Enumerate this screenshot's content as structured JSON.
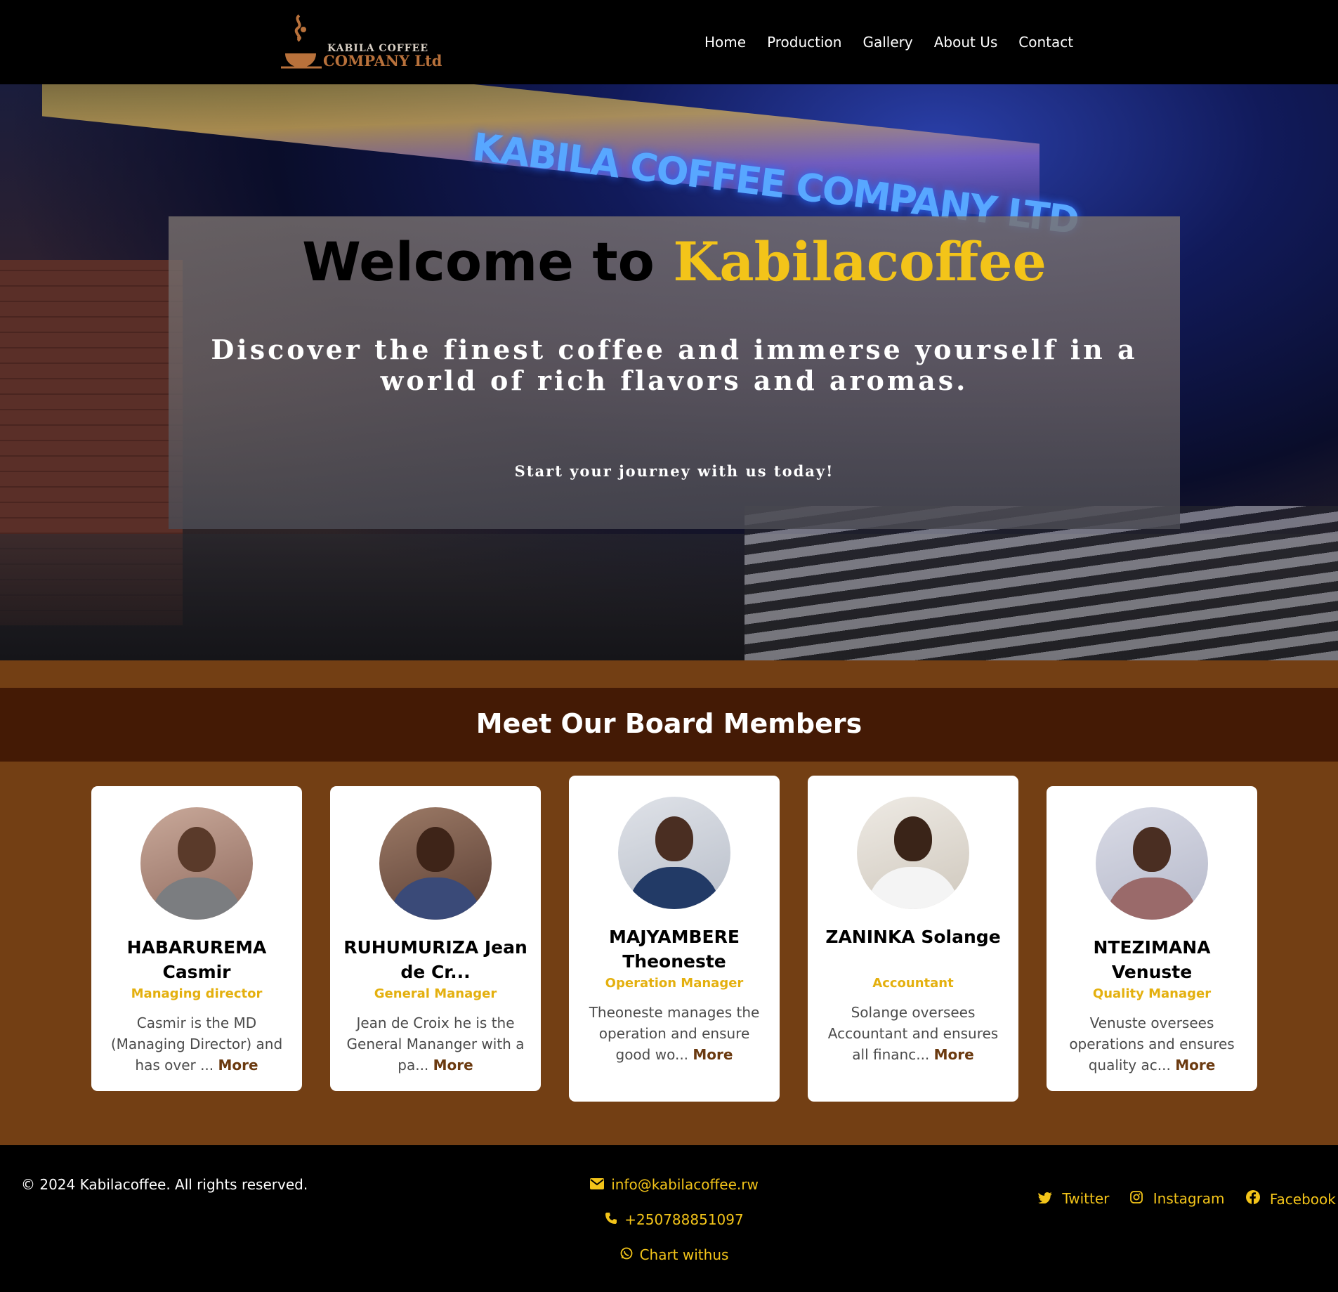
{
  "nav": {
    "logo_line1": "KABILA COFFEE",
    "logo_line2": "COMPANY Ltd",
    "links": [
      "Home",
      "Production",
      "Gallery",
      "About Us",
      "Contact"
    ]
  },
  "hero": {
    "sign_text": "KABILA COFFEE COMPANY LTD",
    "title_prefix": "Welcome to",
    "title_brand": "Kabilacoffee",
    "subtitle": "Discover the finest coffee and immerse yourself in a world of rich flavors and aromas.",
    "cta": "Start your journey with us today!"
  },
  "board": {
    "title": "Meet Our Board Members",
    "more_label": "More",
    "members": [
      {
        "name": "HABARUREMA Casmir",
        "role": "Managing director",
        "desc": "Casmir is the MD (Managing Director) and has over ..."
      },
      {
        "name": "RUHUMURIZA Jean de Cr...",
        "role": "General Manager",
        "desc": "Jean de Croix he is the General Mananger with a pa..."
      },
      {
        "name": "MAJYAMBERE Theoneste",
        "role": "Operation Manager",
        "desc": "Theoneste manages the operation and ensure good wo..."
      },
      {
        "name": "ZANINKA Solange",
        "role": "Accountant",
        "desc": "Solange oversees Accountant and ensures all financ..."
      },
      {
        "name": "NTEZIMANA Venuste",
        "role": "Quality Manager",
        "desc": "Venuste oversees operations and ensures quality ac..."
      }
    ]
  },
  "footer": {
    "copyright": "© 2024 Kabilacoffee. All rights reserved.",
    "email": "info@kabilacoffee.rw",
    "phone": "+250788851097",
    "chat": "Chart withus",
    "social": [
      "Twitter",
      "Instagram",
      "Facebook"
    ]
  },
  "colors": {
    "accent": "#f3c419",
    "board_bg": "#733f14",
    "board_header_bg": "#441a05",
    "more_link": "#6b3a10"
  },
  "icons": {
    "email": "envelope-icon",
    "phone": "phone-icon",
    "chat": "whatsapp-icon",
    "twitter": "twitter-icon",
    "instagram": "instagram-icon",
    "facebook": "facebook-icon"
  }
}
